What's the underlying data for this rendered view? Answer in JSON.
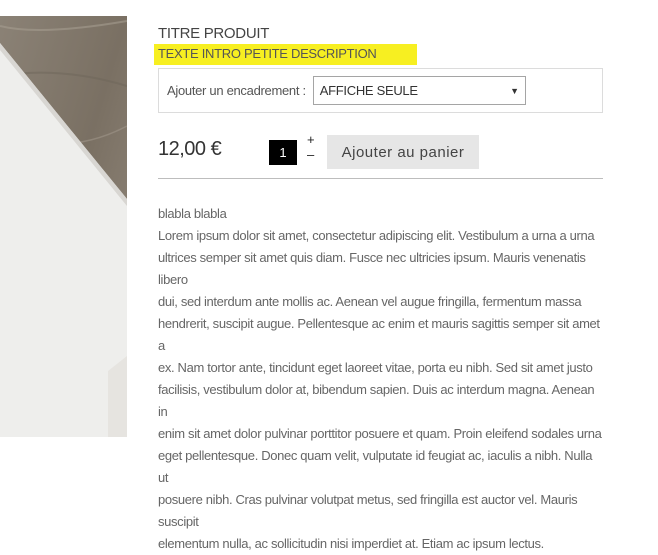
{
  "product": {
    "title": "TITRE PRODUIT",
    "intro": "TEXTE INTRO PETITE DESCRIPTION",
    "highlight_color": "#f7ef21",
    "frame_label": "Ajouter un encadrement :",
    "frame_selected": "AFFICHE SEULE",
    "price": "12,00 €",
    "quantity": "1",
    "increment": "+",
    "decrement": "–",
    "add_to_cart": "Ajouter au panier",
    "description_heading": "blabla blabla",
    "description_lines": [
      "Lorem ipsum dolor sit amet, consectetur adipiscing elit. Vestibulum a urna a urna",
      "ultrices semper sit amet quis diam. Fusce nec ultricies ipsum. Mauris venenatis libero",
      "dui, sed interdum ante mollis ac. Aenean vel augue fringilla, fermentum massa",
      "hendrerit, suscipit augue. Pellentesque ac enim et mauris sagittis semper sit amet a",
      "ex. Nam tortor ante, tincidunt eget laoreet vitae, porta eu nibh. Sed sit amet justo",
      "facilisis, vestibulum dolor at, bibendum sapien. Duis ac interdum magna. Aenean in",
      "enim sit amet dolor pulvinar porttitor posuere et quam. Proin eleifend sodales urna",
      "eget pellentesque. Donec quam velit, vulputate id feugiat ac, iaculis a nibh. Nulla ut",
      "posuere nibh. Cras pulvinar volutpat metus, sed fringilla est auctor vel. Mauris suscipit",
      "elementum nulla, ac sollicitudin nisi imperdiet at. Etiam ac ipsum lectus."
    ]
  }
}
